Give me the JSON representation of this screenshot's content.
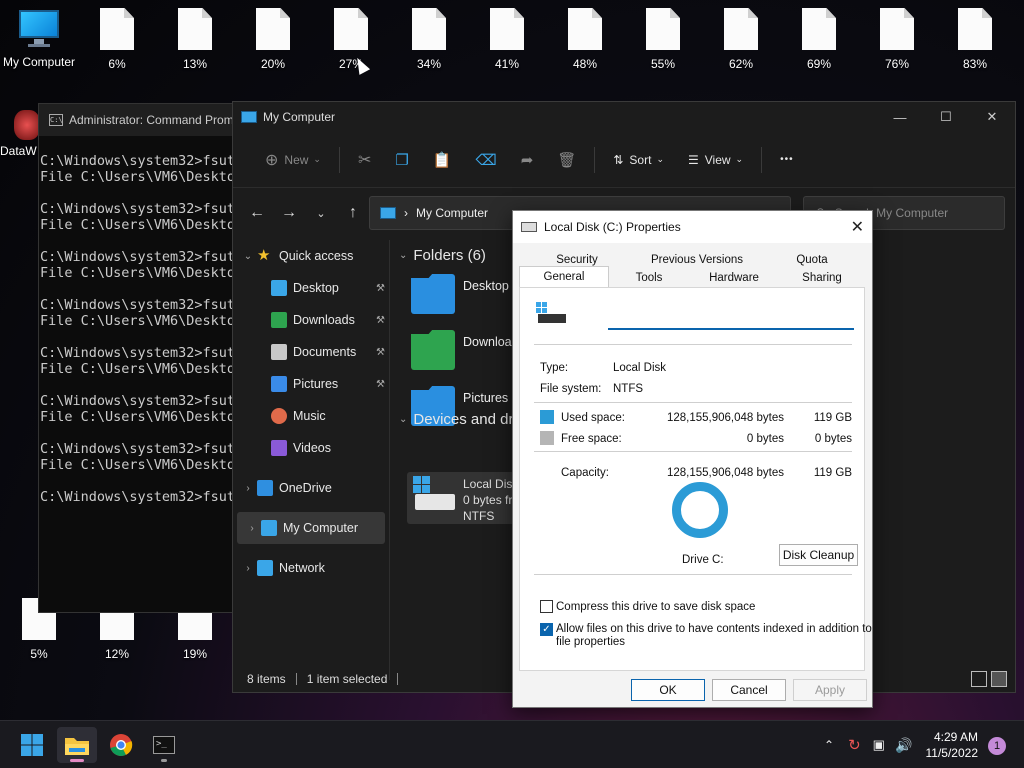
{
  "desktop": {
    "icons_top": [
      {
        "label": "My Computer",
        "type": "monitor"
      },
      {
        "label": "6%"
      },
      {
        "label": "13%"
      },
      {
        "label": "20%"
      },
      {
        "label": "27%"
      },
      {
        "label": "34%"
      },
      {
        "label": "41%"
      },
      {
        "label": "48%"
      },
      {
        "label": "55%"
      },
      {
        "label": "62%"
      },
      {
        "label": "69%"
      },
      {
        "label": "76%"
      },
      {
        "label": "83%"
      }
    ],
    "icons_bottom": [
      {
        "label": "5%"
      },
      {
        "label": "12%"
      },
      {
        "label": "19%"
      }
    ],
    "left_partial_label": "DataW"
  },
  "cmd": {
    "title": "Administrator: Command Prom",
    "lines": [
      "C:\\Windows\\system32>fsut",
      "File C:\\Users\\VM6\\Deskto",
      "",
      "C:\\Windows\\system32>fsut",
      "File C:\\Users\\VM6\\Deskto",
      "",
      "C:\\Windows\\system32>fsut",
      "File C:\\Users\\VM6\\Deskto",
      "",
      "C:\\Windows\\system32>fsut",
      "File C:\\Users\\VM6\\Deskto",
      "",
      "C:\\Windows\\system32>fsut",
      "File C:\\Users\\VM6\\Deskto",
      "",
      "C:\\Windows\\system32>fsut",
      "File C:\\Users\\VM6\\Deskto",
      "",
      "C:\\Windows\\system32>fsut",
      "File C:\\Users\\VM6\\Deskto",
      "",
      "C:\\Windows\\system32>fsut"
    ]
  },
  "explorer": {
    "title": "My Computer",
    "toolbar": {
      "new": "New",
      "sort": "Sort",
      "view": "View",
      "more": "•••"
    },
    "address": "My Computer",
    "search_placeholder": "Search My Computer",
    "sidebar": [
      {
        "label": "Quick access",
        "icon": "star-icon",
        "color": "#f2c12e",
        "chevron": true,
        "indent": false
      },
      {
        "label": "Desktop",
        "icon": "desktop-folder-icon",
        "color": "#3aa6e8",
        "pinned": true,
        "indent": true
      },
      {
        "label": "Downloads",
        "icon": "download-icon",
        "color": "#2ea44f",
        "pinned": true,
        "indent": true
      },
      {
        "label": "Documents",
        "icon": "document-icon",
        "color": "#c8c8c8",
        "pinned": true,
        "indent": true
      },
      {
        "label": "Pictures",
        "icon": "pictures-icon",
        "color": "#3a8be8",
        "pinned": true,
        "indent": true
      },
      {
        "label": "Music",
        "icon": "music-icon",
        "color": "#e06a4a",
        "indent": true
      },
      {
        "label": "Videos",
        "icon": "videos-icon",
        "color": "#8a5ad8",
        "indent": true
      },
      {
        "label": "OneDrive",
        "icon": "onedrive-icon",
        "color": "#2f8fe0",
        "chevron": true,
        "indent": false
      },
      {
        "label": "My Computer",
        "icon": "computer-icon",
        "color": "#3aa6e8",
        "chevron": true,
        "indent": false,
        "selected": true
      },
      {
        "label": "Network",
        "icon": "network-icon",
        "color": "#3aa6e8",
        "chevron": true,
        "indent": false
      }
    ],
    "folders_header": "Folders (6)",
    "folders": [
      {
        "name": "Desktop",
        "color": "#2a8fe0"
      },
      {
        "name": "Downloa",
        "color": "#2ea44f"
      },
      {
        "name": "Pictures",
        "color": "#2a8fe0"
      }
    ],
    "devices_header": "Devices and dr",
    "drive": {
      "name": "Local Disk",
      "free": "0 bytes fr",
      "fs": "NTFS"
    },
    "status": {
      "items": "8 items",
      "selected": "1 item selected"
    }
  },
  "dialog": {
    "title": "Local Disk (C:) Properties",
    "tabs_row1": [
      "Security",
      "Previous Versions",
      "Quota"
    ],
    "tabs_row2": [
      "General",
      "Tools",
      "Hardware",
      "Sharing"
    ],
    "name_value": "",
    "type_label": "Type:",
    "type_value": "Local Disk",
    "fs_label": "File system:",
    "fs_value": "NTFS",
    "used_label": "Used space:",
    "used_bytes": "128,155,906,048 bytes",
    "used_gb": "119 GB",
    "free_label": "Free space:",
    "free_bytes": "0 bytes",
    "free_gb": "0 bytes",
    "cap_label": "Capacity:",
    "cap_bytes": "128,155,906,048 bytes",
    "cap_gb": "119 GB",
    "drive_label": "Drive C:",
    "cleanup": "Disk Cleanup",
    "compress": "Compress this drive to save disk space",
    "index_line1": "Allow files on this drive to have contents indexed in addition to",
    "index_line2": "file properties",
    "compress_checked": false,
    "index_checked": true,
    "ok": "OK",
    "cancel": "Cancel",
    "apply": "Apply",
    "used_color": "#2b9bd6",
    "free_color": "#b5b5b5"
  },
  "taskbar": {
    "time": "4:29 AM",
    "date": "11/5/2022",
    "notifications": "1"
  }
}
